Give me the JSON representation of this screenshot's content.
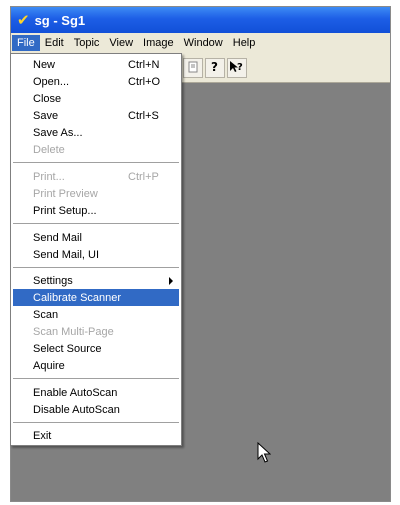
{
  "window": {
    "title": "sg - Sg1"
  },
  "menubar": {
    "items": [
      {
        "label": "File"
      },
      {
        "label": "Edit"
      },
      {
        "label": "Topic"
      },
      {
        "label": "View"
      },
      {
        "label": "Image"
      },
      {
        "label": "Window"
      },
      {
        "label": "Help"
      }
    ]
  },
  "toolbar": {
    "buttons": [
      "print-preview-icon",
      "help-icon",
      "context-help-icon"
    ]
  },
  "file_menu": {
    "items": [
      {
        "label": "New",
        "shortcut": "Ctrl+N"
      },
      {
        "label": "Open...",
        "shortcut": "Ctrl+O"
      },
      {
        "label": "Close"
      },
      {
        "label": "Save",
        "shortcut": "Ctrl+S"
      },
      {
        "label": "Save As..."
      },
      {
        "label": "Delete"
      },
      {
        "label": "Print...",
        "shortcut": "Ctrl+P"
      },
      {
        "label": "Print Preview"
      },
      {
        "label": "Print Setup..."
      },
      {
        "label": "Send Mail"
      },
      {
        "label": "Send Mail, UI"
      },
      {
        "label": "Settings"
      },
      {
        "label": "Calibrate Scanner"
      },
      {
        "label": "Scan"
      },
      {
        "label": "Scan Multi-Page"
      },
      {
        "label": "Select Source"
      },
      {
        "label": "Aquire"
      },
      {
        "label": "Enable AutoScan"
      },
      {
        "label": "Disable AutoScan"
      },
      {
        "label": "Exit"
      }
    ]
  },
  "colors": {
    "title_blue": "#1d5ee6",
    "highlight": "#316ac5",
    "client_gray": "#808080"
  }
}
